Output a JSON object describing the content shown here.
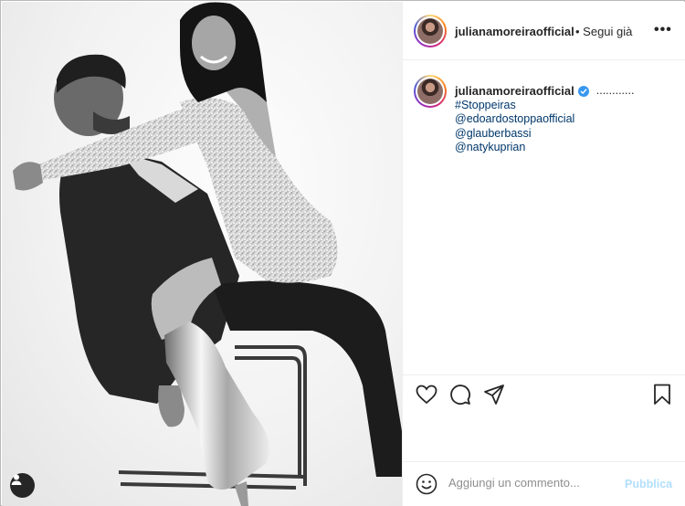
{
  "post": {
    "username": "julianamoreiraofficial",
    "follow_status": "• Segui già",
    "more_label": "•••"
  },
  "caption": {
    "username": "julianamoreiraofficial",
    "dots": "............",
    "lines": [
      "#Stoppeiras",
      "@edoardostoppaofficial",
      "@glauberbassi",
      "@natykuprian"
    ]
  },
  "comment": {
    "placeholder": "Aggiungi un commento...",
    "publish_label": "Pubblica"
  },
  "colors": {
    "link": "#00376b",
    "verified": "#3897f0",
    "publish_disabled": "#b2dffc"
  },
  "icons": {
    "like": "heart-icon",
    "comment": "comment-icon",
    "share": "paper-plane-icon",
    "save": "bookmark-icon",
    "emoji": "smiley-icon",
    "tags": "user-tag-icon"
  }
}
